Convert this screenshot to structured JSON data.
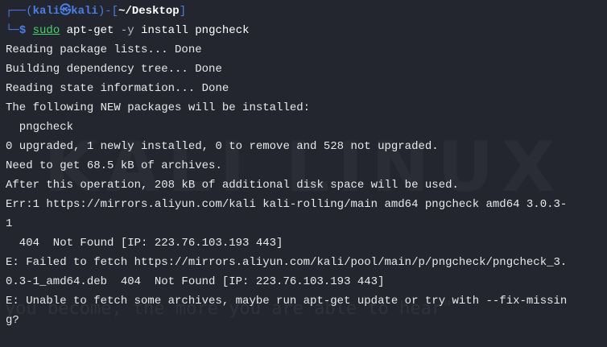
{
  "terminal": {
    "prompt": {
      "tree_top": "┌──",
      "open_paren": "(",
      "user_host": "kali㉿kali",
      "close_paren": ")",
      "dash": "-",
      "cwd_open": "[",
      "cwd": "~/Desktop",
      "cwd_close": "]",
      "tree_bottom": "└─",
      "dollar": "$",
      "command_word": "sudo",
      "command_rest_a": " apt-get",
      "flag": " -y",
      "command_rest_b": " install pngcheck"
    },
    "output_lines": [
      "Reading package lists... Done",
      "Building dependency tree... Done",
      "Reading state information... Done",
      "The following NEW packages will be installed:",
      "  pngcheck",
      "0 upgraded, 1 newly installed, 0 to remove and 528 not upgraded.",
      "Need to get 68.5 kB of archives.",
      "After this operation, 208 kB of additional disk space will be used.",
      "Err:1 https://mirrors.aliyun.com/kali kali-rolling/main amd64 pngcheck amd64 3.0.3-",
      "1",
      "  404  Not Found [IP: 223.76.103.193 443]",
      "E: Failed to fetch https://mirrors.aliyun.com/kali/pool/main/p/pngcheck/pngcheck_3.",
      "0.3-1_amd64.deb  404  Not Found [IP: 223.76.103.193 443]",
      "E: Unable to fetch some archives, maybe run apt-get update or try with --fix-missin",
      "g?"
    ],
    "watermark": "KALI LINUX",
    "background_quote": "you become, the more you are able to hear\""
  },
  "colors": {
    "background": "#23262e",
    "prompt_blue": "#4c7ee8",
    "command_green": "#48d36b",
    "text": "#e9e9e9"
  }
}
